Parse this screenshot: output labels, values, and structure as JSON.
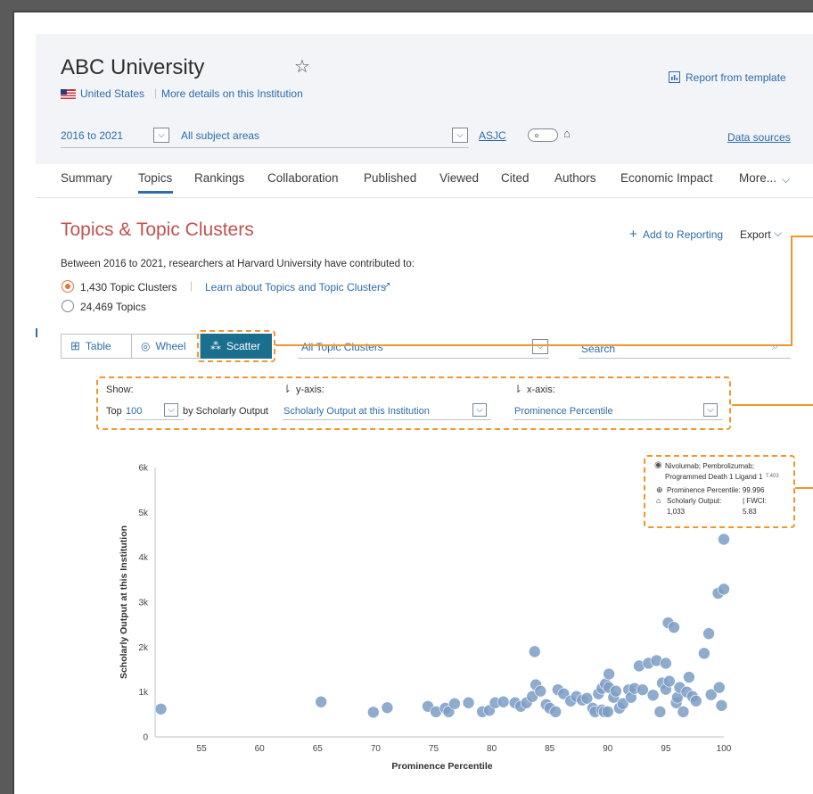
{
  "institution": {
    "name": "ABC University",
    "country": "United States",
    "details_link": "More details on this Institution",
    "report_link": "Report from template"
  },
  "filters": {
    "years": "2016 to 2021",
    "subject": "All subject areas",
    "asjc": "ASJC",
    "data_sources": "Data sources"
  },
  "tabs": [
    "Summary",
    "Topics",
    "Rankings",
    "Collaboration",
    "Published",
    "Viewed",
    "Cited",
    "Authors",
    "Economic Impact",
    "More..."
  ],
  "section": {
    "title": "Topics & Topic Clusters",
    "add_to_reporting": "Add to Reporting",
    "export": "Export",
    "description": "Between 2016 to 2021, researchers at Harvard University have contributed to:",
    "option_clusters": "1,430 Topic Clusters",
    "learn_link": "Learn about Topics and Topic Clusters",
    "option_topics": "24,469 Topics"
  },
  "views": {
    "table": "Table",
    "wheel": "Wheel",
    "scatter": "Scatter",
    "cluster_select": "All Topic Clusters",
    "search_placeholder": "Search"
  },
  "controls": {
    "show_label": "Show:",
    "top_prefix": "Top",
    "top_value": "100",
    "by_text": "by Scholarly Output",
    "y_label": "y-axis:",
    "y_value": "Scholarly Output at this Institution",
    "x_label": "x-axis:",
    "x_value": "Prominence Percentile"
  },
  "tooltip": {
    "name_line1": "Nivolumab; Pembrolizumab;",
    "name_line2": "Programmed Death 1 Ligand 1",
    "code": "T.403",
    "prominence": "Prominence Percentile: 99.996",
    "output_label": "Scholarly Output:",
    "fwci_label": "| FWCI:",
    "output_value": "1,033",
    "fwci_value": "5.83"
  },
  "colors": {
    "accent_blue": "#2e6cab",
    "active_teal": "#1b6f8e",
    "title_red": "#c0524f",
    "annotation_orange": "#f0962c",
    "dot": "#7b9cc4"
  },
  "chart_data": {
    "type": "scatter",
    "xlabel": "Prominence Percentile",
    "ylabel": "Scholarly Output at this Institution",
    "xlim": [
      51,
      100
    ],
    "ylim": [
      0,
      6000
    ],
    "x_ticks": [
      "55",
      "60",
      "65",
      "70",
      "75",
      "80",
      "85",
      "90",
      "95",
      "100"
    ],
    "y_ticks": [
      "0",
      "1k",
      "2k",
      "3k",
      "4k",
      "5k",
      "6k"
    ],
    "points": [
      [
        51.5,
        620
      ],
      [
        65.3,
        780
      ],
      [
        69.8,
        550
      ],
      [
        71.0,
        650
      ],
      [
        74.5,
        680
      ],
      [
        75.2,
        560
      ],
      [
        76.0,
        640
      ],
      [
        76.3,
        560
      ],
      [
        76.8,
        740
      ],
      [
        78.0,
        760
      ],
      [
        79.2,
        560
      ],
      [
        79.8,
        590
      ],
      [
        80.3,
        760
      ],
      [
        81.0,
        780
      ],
      [
        82.0,
        760
      ],
      [
        82.5,
        680
      ],
      [
        83.0,
        760
      ],
      [
        83.5,
        900
      ],
      [
        83.8,
        1160
      ],
      [
        83.7,
        1900
      ],
      [
        84.2,
        1020
      ],
      [
        84.7,
        720
      ],
      [
        85.0,
        640
      ],
      [
        85.5,
        560
      ],
      [
        85.7,
        1050
      ],
      [
        86.2,
        960
      ],
      [
        86.8,
        800
      ],
      [
        87.3,
        900
      ],
      [
        87.8,
        820
      ],
      [
        88.2,
        860
      ],
      [
        88.7,
        640
      ],
      [
        88.9,
        560
      ],
      [
        89.2,
        960
      ],
      [
        89.5,
        1080
      ],
      [
        89.5,
        600
      ],
      [
        89.7,
        560
      ],
      [
        89.8,
        1180
      ],
      [
        90.1,
        1100
      ],
      [
        90.0,
        560
      ],
      [
        90.1,
        1400
      ],
      [
        90.5,
        880
      ],
      [
        90.7,
        1020
      ],
      [
        91.0,
        640
      ],
      [
        91.3,
        740
      ],
      [
        91.8,
        1050
      ],
      [
        92.0,
        880
      ],
      [
        92.3,
        1080
      ],
      [
        92.7,
        1580
      ],
      [
        93.0,
        1050
      ],
      [
        93.5,
        1640
      ],
      [
        93.9,
        930
      ],
      [
        94.2,
        1700
      ],
      [
        94.5,
        560
      ],
      [
        94.7,
        1200
      ],
      [
        95.0,
        1060
      ],
      [
        95.0,
        1640
      ],
      [
        95.2,
        2540
      ],
      [
        95.3,
        1240
      ],
      [
        95.7,
        2440
      ],
      [
        95.9,
        760
      ],
      [
        96.0,
        880
      ],
      [
        96.2,
        1100
      ],
      [
        96.5,
        560
      ],
      [
        96.8,
        1000
      ],
      [
        97.0,
        1330
      ],
      [
        97.3,
        900
      ],
      [
        97.6,
        800
      ],
      [
        98.3,
        1860
      ],
      [
        98.7,
        2300
      ],
      [
        98.9,
        940
      ],
      [
        99.5,
        3200
      ],
      [
        99.6,
        1100
      ],
      [
        99.8,
        700
      ],
      [
        100.0,
        3290
      ],
      [
        100.0,
        4400
      ]
    ]
  }
}
